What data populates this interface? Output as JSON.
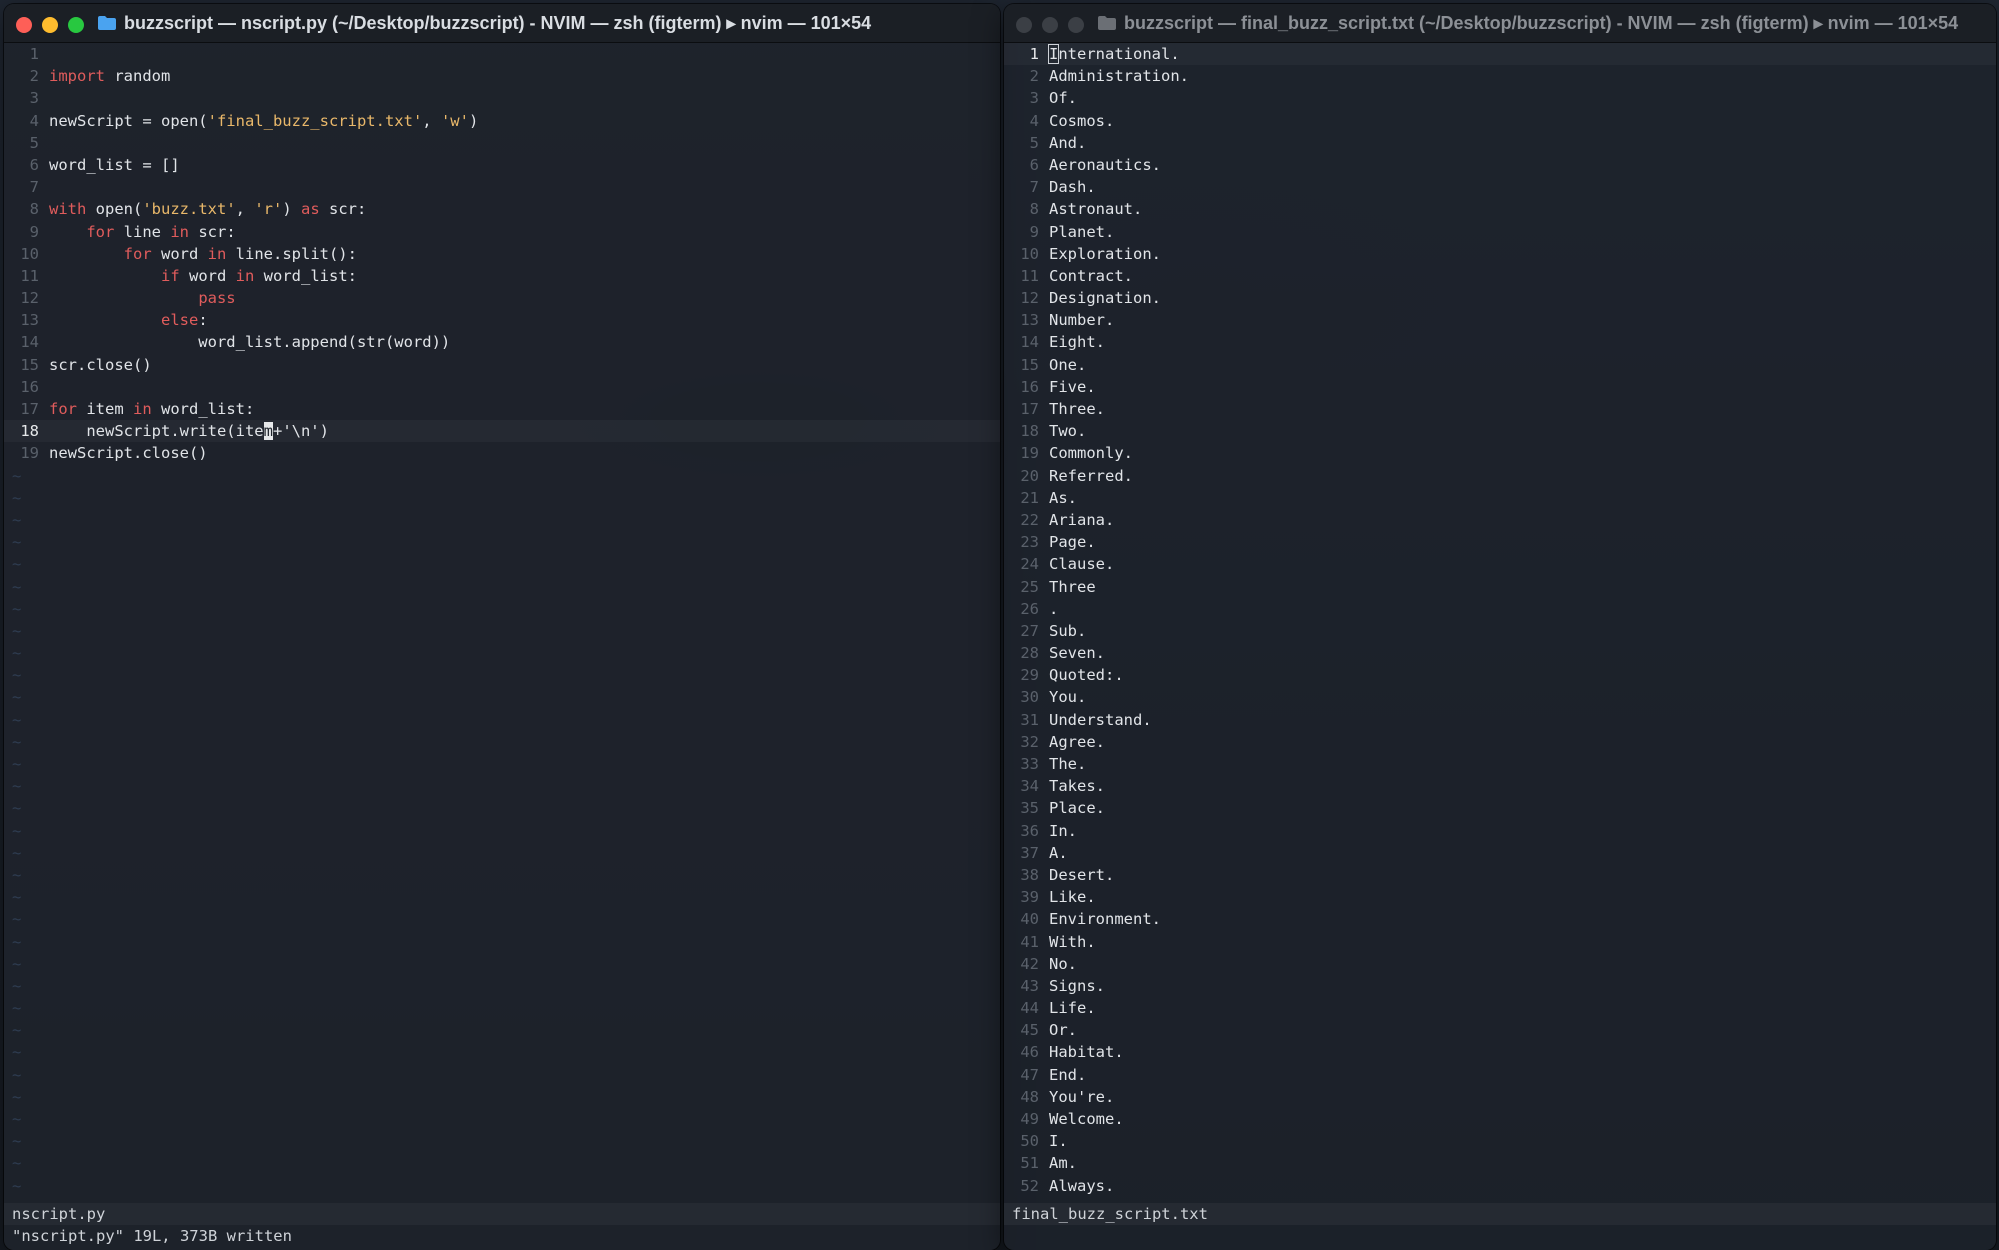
{
  "left_window": {
    "title": "buzzscript — nscript.py (~/Desktop/buzzscript) - NVIM — zsh (figterm) ▸ nvim — 101×54",
    "statusline": "nscript.py",
    "cmdline": "\"nscript.py\" 19L, 373B written",
    "cursor_line": 18,
    "tilde_rows": 33
  },
  "right_window": {
    "title": "buzzscript — final_buzz_script.txt (~/Desktop/buzzscript) - NVIM — zsh (figterm) ▸ nvim — 101×54",
    "statusline": "final_buzz_script.txt",
    "cursor_line": 1,
    "lines": [
      "International.",
      "Administration.",
      "Of.",
      "Cosmos.",
      "And.",
      "Aeronautics.",
      "Dash.",
      "Astronaut.",
      "Planet.",
      "Exploration.",
      "Contract.",
      "Designation.",
      "Number.",
      "Eight.",
      "One.",
      "Five.",
      "Three.",
      "Two.",
      "Commonly.",
      "Referred.",
      "As.",
      "Ariana.",
      "Page.",
      "Clause.",
      "Three",
      ".",
      "Sub.",
      "Seven.",
      "Quoted:.",
      "You.",
      "Understand.",
      "Agree.",
      "The.",
      "Takes.",
      "Place.",
      "In.",
      "A.",
      "Desert.",
      "Like.",
      "Environment.",
      "With.",
      "No.",
      "Signs.",
      "Life.",
      "Or.",
      "Habitat.",
      "End.",
      "You're.",
      "Welcome.",
      "I.",
      "Am.",
      "Always."
    ]
  },
  "colors": {
    "keyword": "#e05c5c",
    "string": "#e9b86a",
    "text": "#e1e4e8",
    "line_number": "#5a616b",
    "tilde": "#2f3d52"
  },
  "code_lines": [
    [],
    [
      {
        "t": "import",
        "c": "kw"
      },
      {
        "t": " random"
      }
    ],
    [],
    [
      {
        "t": "newScript = open("
      },
      {
        "t": "'final_buzz_script.txt'",
        "c": "str"
      },
      {
        "t": ", "
      },
      {
        "t": "'w'",
        "c": "str"
      },
      {
        "t": ")"
      }
    ],
    [],
    [
      {
        "t": "word_list = []"
      }
    ],
    [],
    [
      {
        "t": "with",
        "c": "kw"
      },
      {
        "t": " open("
      },
      {
        "t": "'buzz.txt'",
        "c": "str"
      },
      {
        "t": ", "
      },
      {
        "t": "'r'",
        "c": "str"
      },
      {
        "t": ") "
      },
      {
        "t": "as",
        "c": "kw"
      },
      {
        "t": " scr:"
      }
    ],
    [
      {
        "t": "    "
      },
      {
        "t": "for",
        "c": "kw"
      },
      {
        "t": " line "
      },
      {
        "t": "in",
        "c": "kw"
      },
      {
        "t": " scr:"
      }
    ],
    [
      {
        "t": "        "
      },
      {
        "t": "for",
        "c": "kw"
      },
      {
        "t": " word "
      },
      {
        "t": "in",
        "c": "kw"
      },
      {
        "t": " line.split():"
      }
    ],
    [
      {
        "t": "            "
      },
      {
        "t": "if",
        "c": "kw"
      },
      {
        "t": " word "
      },
      {
        "t": "in",
        "c": "kw"
      },
      {
        "t": " word_list:"
      }
    ],
    [
      {
        "t": "                "
      },
      {
        "t": "pass",
        "c": "kw"
      }
    ],
    [
      {
        "t": "            "
      },
      {
        "t": "else",
        "c": "kw"
      },
      {
        "t": ":"
      }
    ],
    [
      {
        "t": "                word_list.append(str(word))"
      }
    ],
    [
      {
        "t": "scr.close()"
      }
    ],
    [],
    [
      {
        "t": "for",
        "c": "kw"
      },
      {
        "t": " item "
      },
      {
        "t": "in",
        "c": "kw"
      },
      {
        "t": " word_list:"
      }
    ],
    [
      {
        "t": "    newScript.write(ite"
      },
      {
        "t": "m",
        "c": "cursor"
      },
      {
        "t": "+'\\n')"
      }
    ],
    [
      {
        "t": "newScript.close()"
      }
    ]
  ]
}
